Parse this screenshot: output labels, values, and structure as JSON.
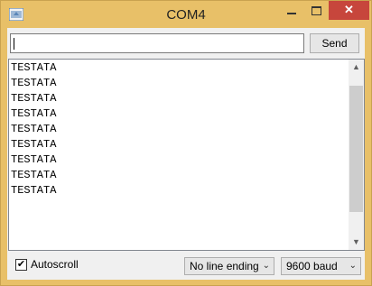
{
  "window": {
    "title": "COM4",
    "close_symbol": "✕"
  },
  "input": {
    "value": ""
  },
  "toolbar": {
    "send_label": "Send"
  },
  "output": {
    "lines": [
      "TESTATA",
      "TESTATA",
      "TESTATA",
      "TESTATA",
      "TESTATA",
      "TESTATA",
      "TESTATA",
      "TESTATA",
      "TESTATA"
    ]
  },
  "footer": {
    "autoscroll_label": "Autoscroll",
    "autoscroll_checked": true,
    "line_ending": "No line ending",
    "baud": "9600 baud"
  },
  "icons": {
    "app": "arduino-app-icon",
    "scroll_up": "chevron-up-icon",
    "scroll_down": "chevron-down-icon"
  },
  "colors": {
    "titlebar": "#e8c068",
    "close": "#c7463c"
  }
}
